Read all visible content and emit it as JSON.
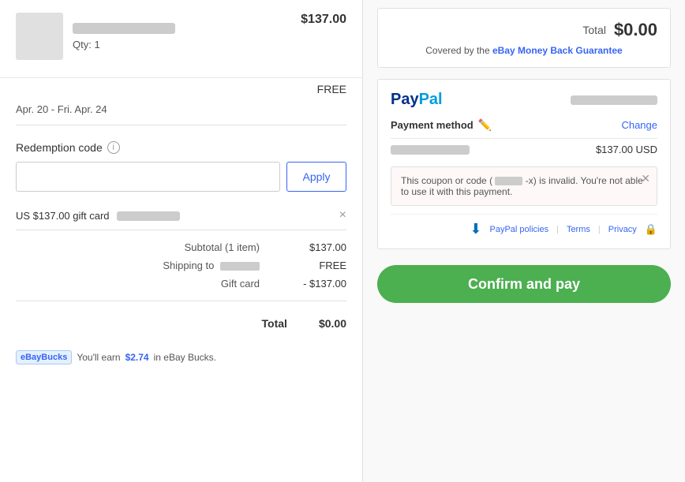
{
  "left": {
    "item": {
      "qty_label": "Qty: 1",
      "price": "$137.00",
      "shipping": "FREE",
      "delivery": "Apr. 20 - Fri. Apr. 24"
    },
    "redemption": {
      "label": "Redemption code",
      "input_placeholder": "",
      "apply_button": "Apply"
    },
    "gift_card": {
      "label": "US $137.00 gift card",
      "remove_label": "×"
    },
    "summary": {
      "subtotal_label": "Subtotal (1 item)",
      "subtotal_value": "$137.00",
      "shipping_label": "Shipping to",
      "shipping_location_blur": true,
      "shipping_value": "FREE",
      "gift_card_label": "Gift card",
      "gift_card_value": "- $137.00",
      "total_label": "Total",
      "total_value": "$0.00"
    },
    "ebay_bucks": {
      "badge": "eBayBucks",
      "text": "You'll earn",
      "amount": "$2.74",
      "suffix": "in eBay Bucks."
    }
  },
  "right": {
    "total_box": {
      "label": "Total",
      "amount": "$0.00",
      "guarantee_text": "Covered by the",
      "guarantee_link": "eBay Money Back Guarantee"
    },
    "paypal": {
      "logo_blue": "Pay",
      "logo_cyan": "Pal",
      "payment_method_label": "Payment method",
      "change_label": "Change",
      "amount": "$137.00 USD",
      "error_message_before": "This coupon or code (",
      "error_code_blur": true,
      "error_message_after": "-x) is invalid. You're not able to use it with this payment.",
      "policies_link": "PayPal policies",
      "terms_link": "Terms",
      "privacy_link": "Privacy"
    },
    "confirm_button": "Confirm and pay"
  }
}
